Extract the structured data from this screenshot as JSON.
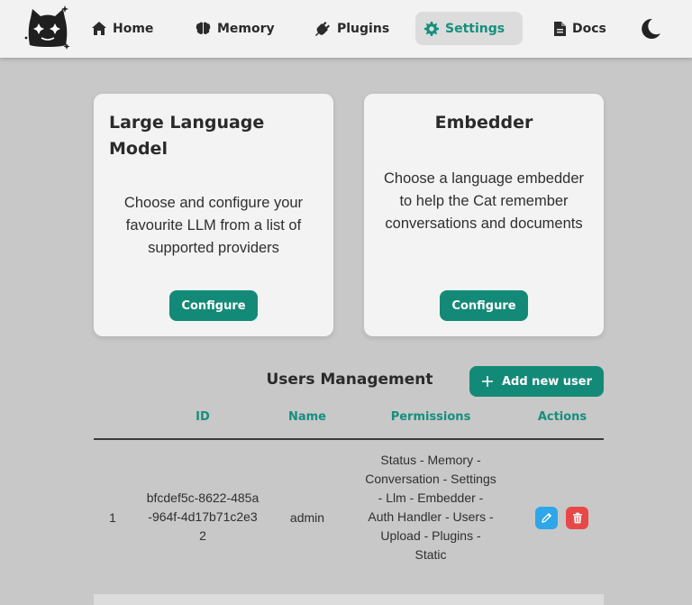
{
  "nav": {
    "items": [
      {
        "label": "Home",
        "icon": "home-icon"
      },
      {
        "label": "Memory",
        "icon": "brain-icon"
      },
      {
        "label": "Plugins",
        "icon": "plug-icon"
      },
      {
        "label": "Settings",
        "icon": "gear-icon",
        "active": true
      },
      {
        "label": "Docs",
        "icon": "document-icon"
      }
    ],
    "theme_icon": "moon-icon"
  },
  "cards": {
    "llm": {
      "title": "Large Language Model",
      "description": "Choose and configure your favourite LLM from a list of supported providers",
      "button": "Configure"
    },
    "embedder": {
      "title": "Embedder",
      "description": "Choose a language embedder to help the Cat remember conversations and documents",
      "button": "Configure"
    }
  },
  "users": {
    "title": "Users Management",
    "add_button": "Add new user",
    "columns": [
      "ID",
      "Name",
      "Permissions",
      "Actions"
    ],
    "rows": [
      {
        "index": "1",
        "id": "bfcdef5c-8622-485a-964f-4d17b71c2e32",
        "name": "admin",
        "permissions": "Status - Memory - Conversation - Settings - Llm - Embedder - Auth Handler - Users - Upload - Plugins - Static"
      }
    ]
  },
  "colors": {
    "accent": "#138a77",
    "accent_text": "#158f7d",
    "edit": "#2fa6ea",
    "delete": "#e94848",
    "background": "#c8c8c8"
  }
}
